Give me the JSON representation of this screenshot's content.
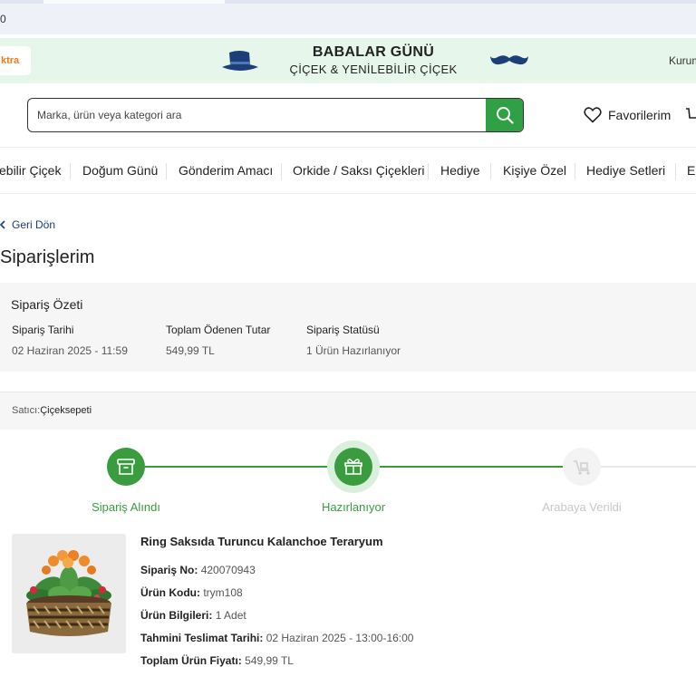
{
  "browser": {
    "tab_counter": "0"
  },
  "banner": {
    "xtra_label": "ktra",
    "title_line1": "BABALAR GÜNÜ",
    "title_line2": "ÇİÇEK & YENİLEBİLİR ÇİÇEK",
    "corporate_link": "Kurum"
  },
  "search": {
    "placeholder": "Marka, ürün veya kategori ara",
    "value": ""
  },
  "header": {
    "favorites_label": "Favorilerim"
  },
  "categories": [
    "ebilir Çiçek",
    "Doğum Günü",
    "Gönderim Amacı",
    "Orkide / Saksı Çiçekleri",
    "Hediye",
    "Kişiye Özel",
    "Hediye Setleri",
    "El"
  ],
  "back_label": "Geri Dön",
  "page_title": "Siparişlerim",
  "summary": {
    "heading": "Sipariş Özeti",
    "date_label": "Sipariş Tarihi",
    "date_value": "02 Haziran 2025 - 11:59",
    "total_label": "Toplam Ödenen Tutar",
    "total_value": "549,99 TL",
    "status_label": "Sipariş Statüsü",
    "status_value": "1 Ürün Hazırlanıyor"
  },
  "seller": {
    "label": "Satıcı:",
    "name": "Çiçeksepeti"
  },
  "progress": {
    "steps": [
      {
        "label": "Sipariş Alındı",
        "icon": "box-icon",
        "state": "done"
      },
      {
        "label": "Hazırlanıyor",
        "icon": "gift-box-icon",
        "state": "active"
      },
      {
        "label": "Arabaya Verildi",
        "icon": "delivery-cart-icon",
        "state": "pending"
      }
    ]
  },
  "product": {
    "name": "Ring Saksıda Turuncu Kalanchoe Teraryum",
    "order_no_label": "Sipariş No:",
    "order_no": "420070943",
    "code_label": "Ürün Kodu:",
    "code": "trym108",
    "info_label": "Ürün Bilgileri:",
    "info": "1 Adet",
    "delivery_label": "Tahmini Teslimat Tarihi:",
    "delivery": "02 Haziran 2025 - 13:00-16:00",
    "price_label": "Toplam Ürün Fiyatı:",
    "price": "549,99 TL"
  },
  "colors": {
    "brand_green": "#2fa044",
    "step_green": "#3a9c3f",
    "link_blue": "#1d3c78",
    "banner_bg": "#e6f6ea",
    "panel_bg": "#f6f6f6"
  }
}
